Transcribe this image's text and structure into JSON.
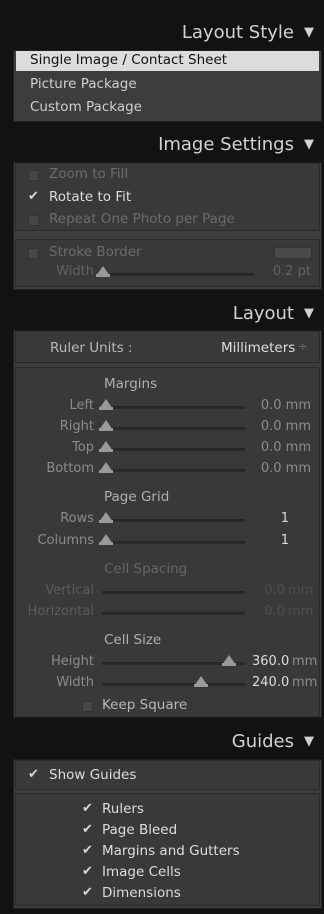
{
  "layout_style": {
    "header": "Layout Style",
    "items": [
      "Single Image / Contact Sheet",
      "Picture Package",
      "Custom Package"
    ],
    "selected": "Single Image / Contact Sheet"
  },
  "image_settings": {
    "header": "Image Settings",
    "zoom_to_fill": "Zoom to Fill",
    "rotate_to_fit": "Rotate to Fit",
    "repeat_one_photo": "Repeat One Photo per Page",
    "stroke_border": "Stroke Border",
    "width_label": "Width",
    "width_value": "0.2 pt",
    "stroke_color": "#4a4a4a"
  },
  "layout": {
    "header": "Layout",
    "ruler_units_label": "Ruler Units :",
    "ruler_units_value": "Millimeters",
    "margins": {
      "title": "Margins",
      "left": "Left",
      "left_value": "0.0 mm",
      "right": "Right",
      "right_value": "0.0 mm",
      "top": "Top",
      "top_value": "0.0 mm",
      "bottom": "Bottom",
      "bottom_value": "0.0 mm"
    },
    "page_grid": {
      "title": "Page Grid",
      "rows": "Rows",
      "rows_value": "1",
      "columns": "Columns",
      "columns_value": "1"
    },
    "cell_spacing": {
      "title": "Cell Spacing",
      "vertical": "Vertical",
      "vertical_value": "0.0",
      "horizontal": "Horizontal",
      "horizontal_value": "0.0",
      "unit": "mm"
    },
    "cell_size": {
      "title": "Cell Size",
      "height": "Height",
      "height_value": "360.0",
      "width": "Width",
      "width_value": "240.0",
      "unit": "mm",
      "keep_square": "Keep Square"
    }
  },
  "guides": {
    "header": "Guides",
    "show_guides": "Show Guides",
    "rulers": "Rulers",
    "page_bleed": "Page Bleed",
    "margins_and_gutters": "Margins and Gutters",
    "image_cells": "Image Cells",
    "dimensions": "Dimensions"
  },
  "icons": {
    "triangle": "▼",
    "check": "✔",
    "stepper": "÷"
  }
}
